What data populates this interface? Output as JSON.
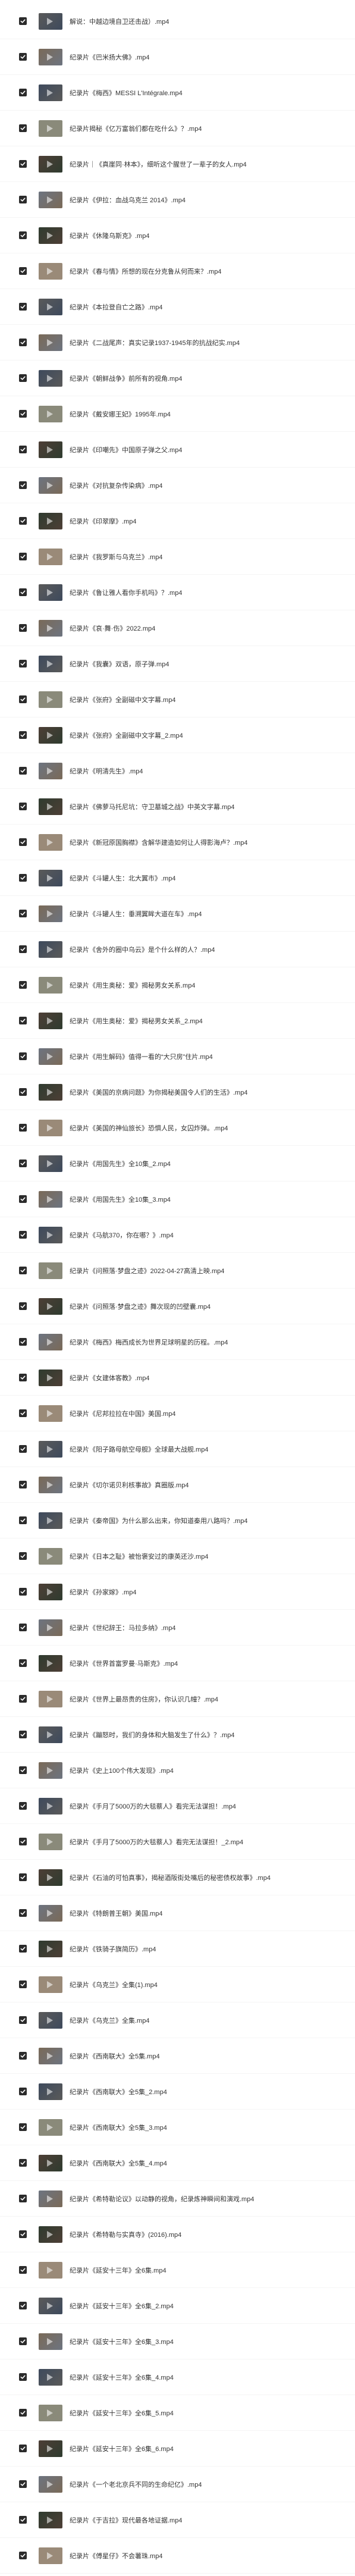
{
  "file_list": {
    "items": [
      {
        "name": "解说：中越边境自卫还击战）.mp4",
        "selected": true
      },
      {
        "name": "纪录片《巴米扬大佛》.mp4",
        "selected": true
      },
      {
        "name": "纪录片《梅西》MESSI L'Intégrale.mp4",
        "selected": true
      },
      {
        "name": "纪录片揭秘《亿万富翁们都在吃什么》？.mp4",
        "selected": true
      },
      {
        "name": "纪录片｜《真崖同·林本》，细听这个腥世了一辈子的女人.mp4",
        "selected": true
      },
      {
        "name": "纪录片《伊拉：血战乌克兰 2014》.mp4",
        "selected": true
      },
      {
        "name": "纪录片《休隆乌斯克》.mp4",
        "selected": true
      },
      {
        "name": "纪录片《春与情》所想的现在分克鲁从何而来？.mp4",
        "selected": true
      },
      {
        "name": "纪录片《本拉登自亡之路》.mp4",
        "selected": true
      },
      {
        "name": "纪录片《二战尾声：真实记录1937-1945年的抗战纪实.mp4",
        "selected": true
      },
      {
        "name": "纪录片《朝鲜战争》前所有的视角.mp4",
        "selected": true
      },
      {
        "name": "纪录片《戴安娜王妃》1995年.mp4",
        "selected": true
      },
      {
        "name": "纪录片《印嘲先》中国原子弹之父.mp4",
        "selected": true
      },
      {
        "name": "纪录片《对抗复杂传染病》.mp4",
        "selected": true
      },
      {
        "name": "纪录片《印翠摩》.mp4",
        "selected": true
      },
      {
        "name": "纪录片《我罗斯与乌克兰》.mp4",
        "selected": true
      },
      {
        "name": "纪录片《鲁让雅人看你手机吗》？.mp4",
        "selected": true
      },
      {
        "name": "纪录片《哀·舞·伤》2022.mp4",
        "selected": true
      },
      {
        "name": "纪录片《我囊》双语，原子弹.mp4",
        "selected": true
      },
      {
        "name": "纪录片《张府》全副磁中文字幕.mp4",
        "selected": true
      },
      {
        "name": "纪录片《张府》全副磁中文字幕_2.mp4",
        "selected": true
      },
      {
        "name": "纪录片《明清先生》.mp4",
        "selected": true
      },
      {
        "name": "纪录片《佛萝马托尼坑：守卫墓城之战》中英文字幕.mp4",
        "selected": true
      },
      {
        "name": "纪录片《新冠原国胸襟》含解华建造如何让人得影海卢？.mp4",
        "selected": true
      },
      {
        "name": "纪录片《斗罐人生：北大翼市》.mp4",
        "selected": true
      },
      {
        "name": "纪录片《斗罐人生：垂溯翼眸大道在车》.mp4",
        "selected": true
      },
      {
        "name": "纪录片《舍外的圈中乌云》是个什么样的人？.mp4",
        "selected": true
      },
      {
        "name": "纪录片《用生奥秘：爱》揭秘男女关系.mp4",
        "selected": true
      },
      {
        "name": "纪录片《用生奥秘：爱》揭秘男女关系_2.mp4",
        "selected": true
      },
      {
        "name": "纪录片《用生解码》值得一看的“大只房”住片.mp4",
        "selected": true
      },
      {
        "name": "纪录片《美国的京病问题》为你揭秘美国令人们的生活》.mp4",
        "selected": true
      },
      {
        "name": "纪录片《美国的神仙旅长》恐惧人民，女囚炸弹。.mp4",
        "selected": true
      },
      {
        "name": "纪录片《用国先生》全10集_2.mp4",
        "selected": true
      },
      {
        "name": "纪录片《用国先生》全10集_3.mp4",
        "selected": true
      },
      {
        "name": "纪录片《马航370，你在哪？》.mp4",
        "selected": true
      },
      {
        "name": "纪录片《问照落·梦盘之迹》2022-04-27高清上映.mp4",
        "selected": true
      },
      {
        "name": "纪录片《问照落·梦盘之迹》舞次现的凹壁囊.mp4",
        "selected": true
      },
      {
        "name": "纪录片《梅西》梅西成长为世界足球明星的历程。.mp4",
        "selected": true
      },
      {
        "name": "纪录片《女建体客教》.mp4",
        "selected": true
      },
      {
        "name": "纪录片《尼邦拉拉在中国》美国.mp4",
        "selected": true
      },
      {
        "name": "纪录片《阳子路母航空母舰》全球最大战舰.mp4",
        "selected": true
      },
      {
        "name": "纪录片《切尔诺贝利核事故》真圈版.mp4",
        "selected": true
      },
      {
        "name": "纪录片《秦帝国》为什么那么出来，你知道秦用八路吗？.mp4",
        "selected": true
      },
      {
        "name": "纪录片《日本之耻》被怡褒安过的康英还沙.mp4",
        "selected": true
      },
      {
        "name": "纪录片《孙家嫁》.mp4",
        "selected": true
      },
      {
        "name": "纪录片《世纪辞王：马拉多纳》.mp4",
        "selected": true
      },
      {
        "name": "纪录片《世界首富罗曼·马斯克》.mp4",
        "selected": true
      },
      {
        "name": "纪录片《世界上最昂贵的住房》，你认识几幢？.mp4",
        "selected": true
      },
      {
        "name": "纪录片《蹦怒时，我们的身体和大脑发生了什么》？.mp4",
        "selected": true
      },
      {
        "name": "纪录片《史上100个伟大发现》.mp4",
        "selected": true
      },
      {
        "name": "纪录片《手月了5000万的大毯蔡人》看完无法谋担！.mp4",
        "selected": true
      },
      {
        "name": "纪录片《手月了5000万的大毯蔡人》看完无法谋担！_2.mp4",
        "selected": true
      },
      {
        "name": "纪录片《石油的可怕真事》，揭秘酒阪街处嘴后的秘密债权故事》.mp4",
        "selected": true
      },
      {
        "name": "纪录片《特朗普王朝》美国.mp4",
        "selected": true
      },
      {
        "name": "纪录片《铁骑子旗简历》.mp4",
        "selected": true
      },
      {
        "name": "纪录片《乌克兰》全集(1).mp4",
        "selected": true
      },
      {
        "name": "纪录片《乌克兰》全集.mp4",
        "selected": true
      },
      {
        "name": "纪录片《西南联大》全5集.mp4",
        "selected": true
      },
      {
        "name": "纪录片《西南联大》全5集_2.mp4",
        "selected": true
      },
      {
        "name": "纪录片《西南联大》全5集_3.mp4",
        "selected": true
      },
      {
        "name": "纪录片《西南联大》全5集_4.mp4",
        "selected": true
      },
      {
        "name": "纪录片《希特勒论议》以动静的视角，纪录炼神瞬间和演戏.mp4",
        "selected": true
      },
      {
        "name": "纪录片《希特勒与实真寺》(2016).mp4",
        "selected": true
      },
      {
        "name": "纪录片《延安十三年》全6集.mp4",
        "selected": true
      },
      {
        "name": "纪录片《延安十三年》全6集_2.mp4",
        "selected": true
      },
      {
        "name": "纪录片《延安十三年》全6集_3.mp4",
        "selected": true
      },
      {
        "name": "纪录片《延安十三年》全6集_4.mp4",
        "selected": true
      },
      {
        "name": "纪录片《延安十三年》全6集_5.mp4",
        "selected": true
      },
      {
        "name": "纪录片《延安十三年》全6集_6.mp4",
        "selected": true
      },
      {
        "name": "纪录片《一个老北京兵不同的生命纪亿》.mp4",
        "selected": true
      },
      {
        "name": "纪录片《于吉拉》现代最各地证据.mp4",
        "selected": true
      },
      {
        "name": "纪录片《傅星仔》不会薯珠.mp4",
        "selected": true
      }
    ]
  },
  "colors": {
    "checkbox_fill": "#2b2b2b",
    "check_mark": "#ffffff",
    "text": "#333333",
    "thumbnail_palette": [
      "#5a5a5a",
      "#7a6a58",
      "#3e4a5c",
      "#8a8a7a",
      "#4d3f36",
      "#6d7480",
      "#2f3b2f",
      "#9a8a78"
    ]
  },
  "icons": {
    "checkbox": "checkbox-checked-icon",
    "thumbnail": "video-thumbnail"
  }
}
